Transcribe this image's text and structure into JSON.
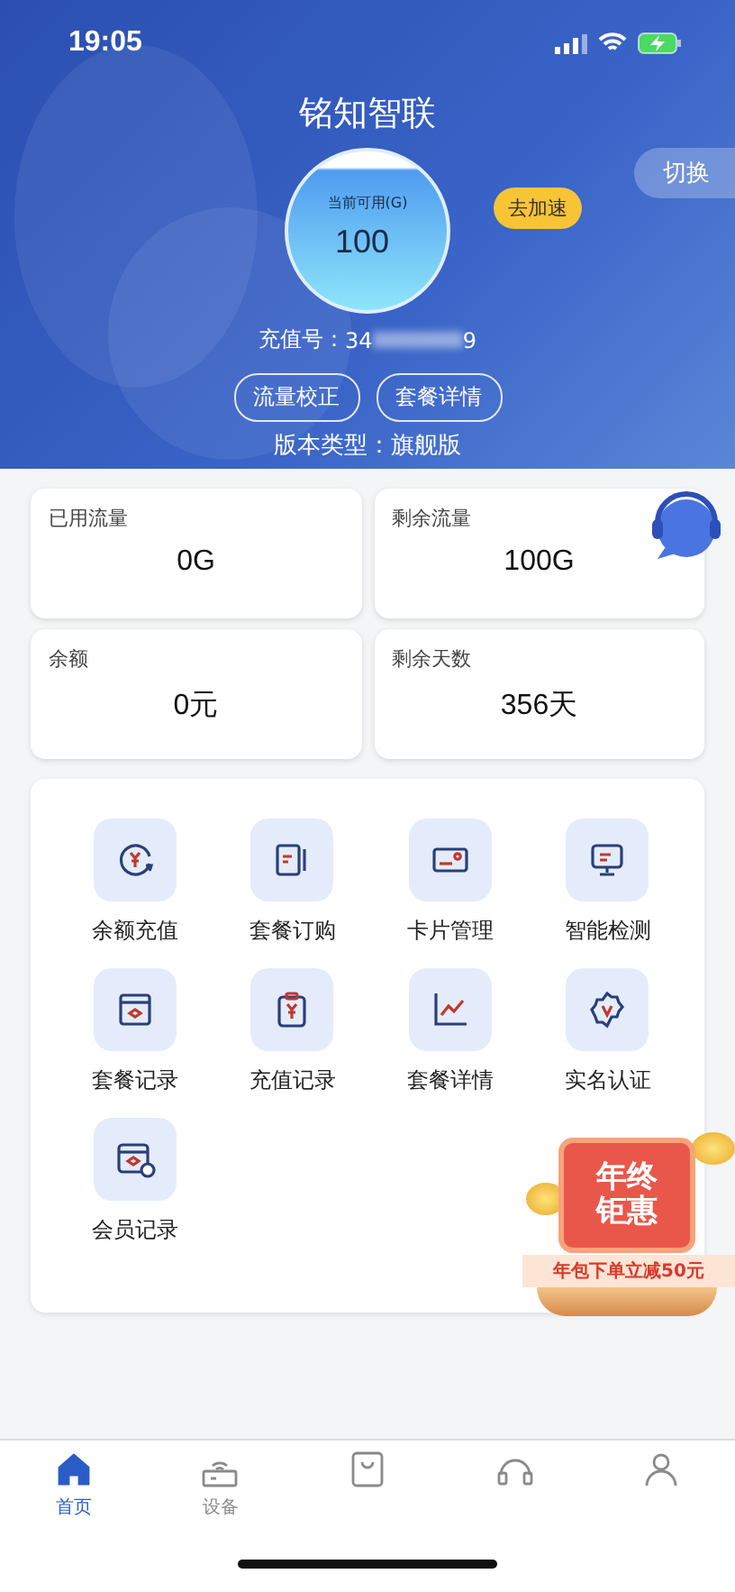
{
  "status_bar": {
    "time": "19:05"
  },
  "header": {
    "title": "铭知智联",
    "switch_label": "切换",
    "gauge": {
      "caption": "当前可用(G)",
      "value": "100"
    },
    "boost_label": "去加速",
    "recharge": {
      "label": "充值号：",
      "prefix": "34",
      "suffix": "9"
    },
    "buttons": [
      "流量校正",
      "套餐详情"
    ],
    "version": "版本类型：旗舰版"
  },
  "stats": [
    {
      "label": "已用流量",
      "value": "0G"
    },
    {
      "label": "剩余流量",
      "value": "100G"
    },
    {
      "label": "余额",
      "value": "0元"
    },
    {
      "label": "剩余天数",
      "value": "356天"
    }
  ],
  "menu": [
    {
      "label": "余额充值",
      "kind": "topup"
    },
    {
      "label": "套餐订购",
      "kind": "order"
    },
    {
      "label": "卡片管理",
      "kind": "card"
    },
    {
      "label": "智能检测",
      "kind": "detect"
    },
    {
      "label": "套餐记录",
      "kind": "planlog"
    },
    {
      "label": "充值记录",
      "kind": "paylog"
    },
    {
      "label": "套餐详情",
      "kind": "detail"
    },
    {
      "label": "实名认证",
      "kind": "verify"
    },
    {
      "label": "会员记录",
      "kind": "member"
    }
  ],
  "promo": {
    "title_1": "年终",
    "title_2": "钜惠",
    "subtitle": "年包下单立减50元"
  },
  "tab_bar": [
    {
      "label": "首页",
      "kind": "home",
      "selected": true
    },
    {
      "label": "设备",
      "kind": "device",
      "selected": false
    },
    {
      "kind": "shop",
      "selected": false
    },
    {
      "kind": "service",
      "selected": false
    },
    {
      "kind": "mine",
      "selected": false
    }
  ]
}
